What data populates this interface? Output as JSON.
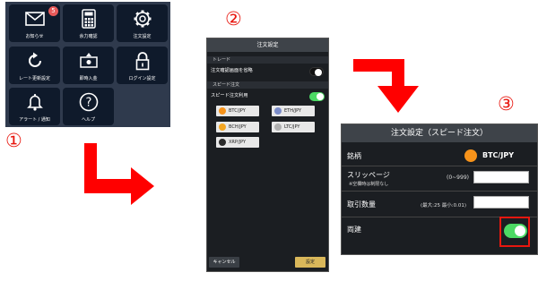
{
  "step_numbers": [
    "①",
    "②",
    "③"
  ],
  "menu": {
    "badge": "5",
    "tiles": [
      {
        "label": "お知らせ",
        "icon": "mail-icon"
      },
      {
        "label": "余力確認",
        "icon": "calculator-icon"
      },
      {
        "label": "注文設定",
        "icon": "gear-icon"
      },
      {
        "label": "レート更新設定",
        "icon": "refresh-icon"
      },
      {
        "label": "即時入金",
        "icon": "cash-icon"
      },
      {
        "label": "ログイン設定",
        "icon": "lock-icon"
      },
      {
        "label": "アラート / 通知",
        "icon": "bell-icon"
      },
      {
        "label": "ヘルプ",
        "icon": "help-icon"
      }
    ]
  },
  "order_settings": {
    "title": "注文設定",
    "section_trade": "トレード",
    "skip_confirm_label": "注文確認画面を省略",
    "skip_confirm_on": false,
    "section_speed": "スピード注文",
    "speed_use_label": "スピード注文利用",
    "speed_use_on": true,
    "pairs": [
      "BTC/JPY",
      "ETH/JPY",
      "BCH/JPY",
      "LTC/JPY",
      "XRP/JPY"
    ],
    "cancel_label": "キャンセル",
    "confirm_label": "設定"
  },
  "speed_settings": {
    "title": "注文設定（スピード注文）",
    "symbol_label": "銘柄",
    "symbol_value": "BTC/JPY",
    "slippage_label": "スリッページ",
    "slippage_range": "(0~999)",
    "slippage_note": "※空欄時は制限なし",
    "quantity_label": "取引数量",
    "quantity_range": "(最大:25 最小:0.01)",
    "hedge_label": "両建",
    "hedge_on": true
  },
  "colors": {
    "accent_red": "#e8170f",
    "toggle_green": "#4cd964",
    "panel_dark": "#1b1e22",
    "confirm_gold": "#d9b75a"
  }
}
